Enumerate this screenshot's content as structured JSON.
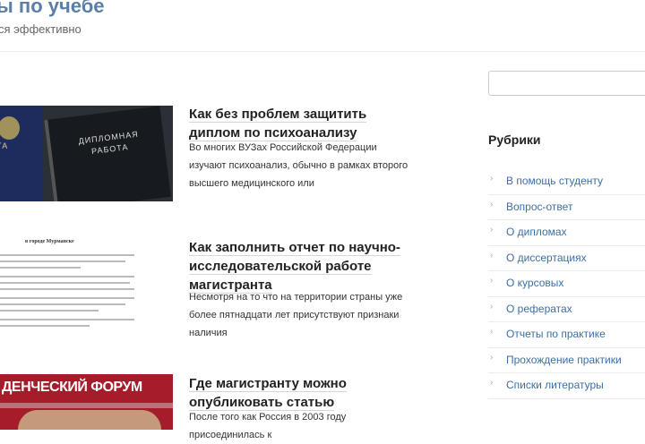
{
  "header": {
    "site_title": "ы по учебе",
    "site_description": "ся эффективно"
  },
  "posts": [
    {
      "title": "Как без проблем защитить диплом по психоанализу",
      "excerpt": "Во многих ВУЗах Российской Федерации изучают психоанализ, обычно в рамках второго высшего медицинского или",
      "thumb_text": [
        "ДИПЛОМНАЯ РАБОТА",
        "ОТА"
      ]
    },
    {
      "title": "Как заполнить отчет по научно-исследовательской работе магистранта",
      "excerpt": "Несмотря на то что на территории страны уже более пятнадцати лет присутствуют признаки наличия",
      "thumb_text": [
        "в городе Мурманске"
      ]
    },
    {
      "title": "Где магистранту можно опубликовать статью",
      "excerpt": "После того как Россия в 2003 году присоединилась к",
      "thumb_text": [
        "ДЕНЧЕСКИЙ ФОРУМ"
      ]
    }
  ],
  "sidebar": {
    "search_placeholder": "",
    "widget_title": "Рубрики",
    "categories": [
      "В помощь студенту",
      "Вопрос-ответ",
      "О дипломах",
      "О диссертациях",
      "О курсовых",
      "О рефератах",
      "Отчеты по практике",
      "Прохождение практики",
      "Списки литературы"
    ]
  },
  "icons": {
    "category_bullet": "chevron-right-icon"
  },
  "colors": {
    "site_title": "#5a7fa6",
    "link": "#3d6fa3",
    "banner": "#a51d2b"
  }
}
